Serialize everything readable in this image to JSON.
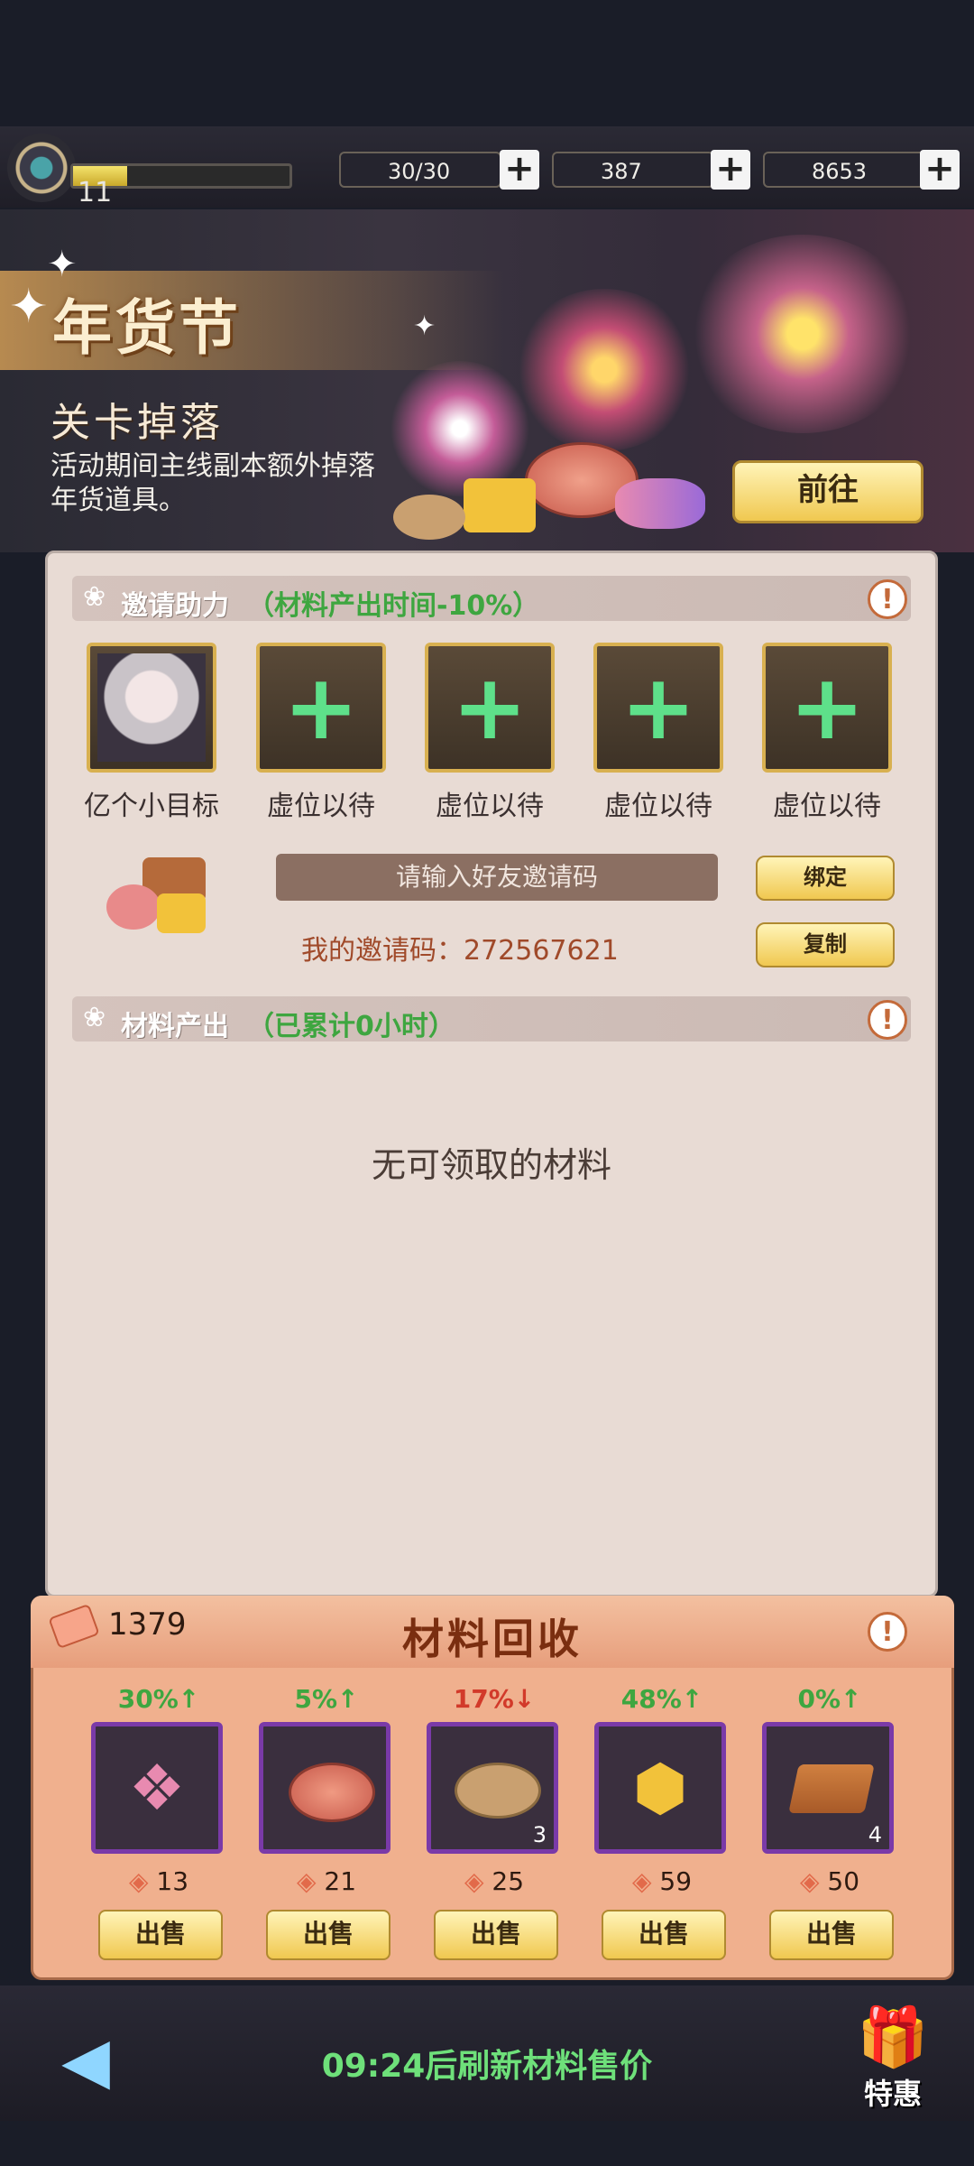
{
  "status_bar": {
    "level": "11",
    "xp_fraction": 0.25,
    "energy": "30/30",
    "diamonds": "387",
    "coins": "8653"
  },
  "banner": {
    "title": "年货节",
    "subtitle": "关卡掉落",
    "description": "活动期间主线副本额外掉落年货道具。",
    "goto_label": "前往"
  },
  "invite": {
    "title": "邀请助力",
    "note": "（材料产出时间-10%）",
    "slots": [
      {
        "label": "亿个小目标",
        "filled": true
      },
      {
        "label": "虚位以待",
        "filled": false
      },
      {
        "label": "虚位以待",
        "filled": false
      },
      {
        "label": "虚位以待",
        "filled": false
      },
      {
        "label": "虚位以待",
        "filled": false
      }
    ],
    "input_placeholder": "请输入好友邀请码",
    "bind_label": "绑定",
    "copy_label": "复制",
    "my_code_text": "我的邀请码：272567621"
  },
  "output": {
    "title": "材料产出",
    "note": "（已累计0小时）",
    "empty_text": "无可领取的材料"
  },
  "recycle": {
    "title": "材料回收",
    "tickets": "1379",
    "sell_label": "出售",
    "items": [
      {
        "icon": "candy-icon",
        "pct": "30%↑",
        "trend": "up",
        "qty": "",
        "price": "13"
      },
      {
        "icon": "macaron-icon",
        "pct": "5%↑",
        "trend": "up",
        "qty": "",
        "price": "21"
      },
      {
        "icon": "almond-icon",
        "pct": "17%↓",
        "trend": "down",
        "qty": "3",
        "price": "25"
      },
      {
        "icon": "honeycomb-icon",
        "pct": "48%↑",
        "trend": "up",
        "qty": "",
        "price": "59"
      },
      {
        "icon": "chocolate-icon",
        "pct": "0%↑",
        "trend": "up",
        "qty": "4",
        "price": "50"
      }
    ]
  },
  "footer": {
    "refresh_text": "09:24后刷新材料售价",
    "special_label": "特惠"
  },
  "colors": {
    "up": "#3ea640",
    "down": "#d23a2a",
    "accent_gold": "#f0c850"
  }
}
